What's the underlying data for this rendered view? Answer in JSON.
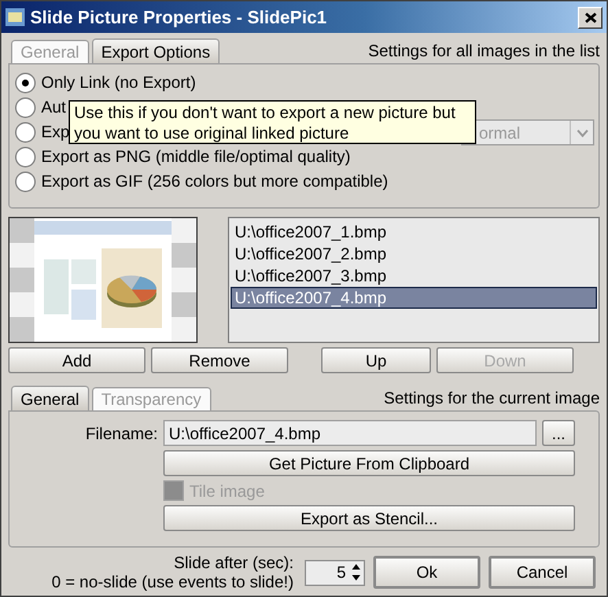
{
  "window": {
    "title": "Slide Picture Properties - SlidePic1"
  },
  "export_tabs": [
    {
      "label": "General",
      "selected": false
    },
    {
      "label": "Export Options",
      "selected": true
    }
  ],
  "export_caption": "Settings for all images in the list",
  "export_options": [
    {
      "label": "Only Link (no Export)",
      "selected": true
    },
    {
      "label": "Aut",
      "selected": false
    },
    {
      "label": "Exp",
      "selected": false
    },
    {
      "label": "Export as PNG (middle file/optimal quality)",
      "selected": false
    },
    {
      "label": "Export as GIF (256 colors but more compatible)",
      "selected": false
    }
  ],
  "quality_dropdown": {
    "value": "ormal",
    "disabled": true
  },
  "tooltip": "Use this if you don't want to export a new picture but you want to use original linked picture",
  "files": [
    {
      "name": "U:\\office2007_1.bmp",
      "selected": false
    },
    {
      "name": "U:\\office2007_2.bmp",
      "selected": false
    },
    {
      "name": "U:\\office2007_3.bmp",
      "selected": false
    },
    {
      "name": "U:\\office2007_4.bmp",
      "selected": true
    }
  ],
  "list_buttons": [
    {
      "label": "Add",
      "disabled": false
    },
    {
      "label": "Remove",
      "disabled": false
    },
    {
      "label": "Up",
      "disabled": false
    },
    {
      "label": "Down",
      "disabled": true
    }
  ],
  "image_tabs": [
    {
      "label": "General",
      "selected": true
    },
    {
      "label": "Transparency",
      "selected": false
    }
  ],
  "image_caption": "Settings for the current image",
  "filename": {
    "label": "Filename:",
    "value": "U:\\office2007_4.bmp"
  },
  "browse_button": "...",
  "clipboard_button": "Get Picture From Clipboard",
  "tile_image": {
    "label": "Tile image",
    "checked": false,
    "disabled": true
  },
  "stencil_button": "Export as Stencil...",
  "slide_after": {
    "label": "Slide after (sec):",
    "hint": "0 = no-slide (use events to slide!)",
    "value": "5"
  },
  "buttons": [
    {
      "label": "Ok"
    },
    {
      "label": "Cancel"
    }
  ]
}
